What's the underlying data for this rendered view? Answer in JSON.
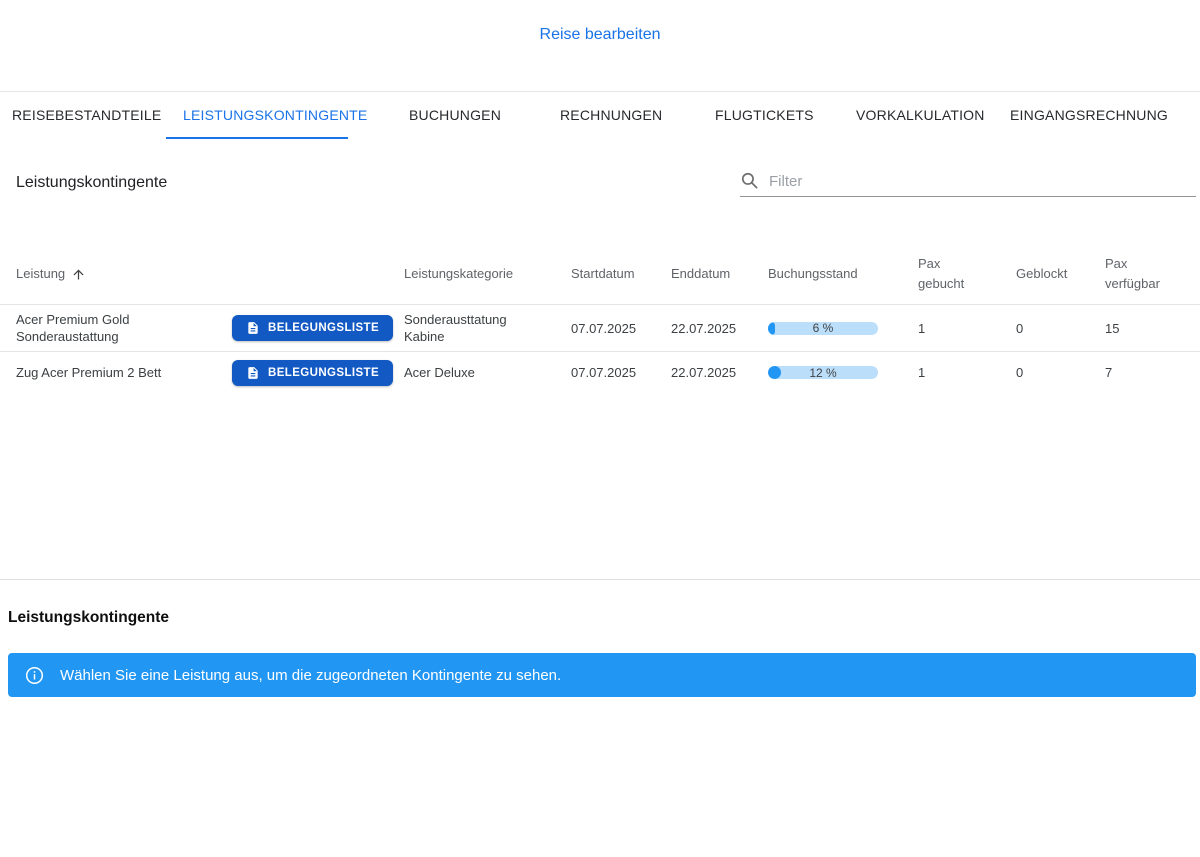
{
  "header": {
    "action_label": "Reise bearbeiten"
  },
  "tabs": {
    "active_index": 1,
    "items": [
      {
        "label": "REISEBESTANDTEILE"
      },
      {
        "label": "LEISTUNGSKONTINGENTE"
      },
      {
        "label": "BUCHUNGEN"
      },
      {
        "label": "RECHNUNGEN"
      },
      {
        "label": "FLUGTICKETS"
      },
      {
        "label": "VORKALKULATION"
      },
      {
        "label": "EINGANGSRECHNUNG"
      }
    ]
  },
  "kontingente_section": {
    "title": "Leistungskontingente",
    "filter": {
      "icon": "search-icon",
      "placeholder": "Filter",
      "value": ""
    },
    "table": {
      "columns": {
        "leistung": "Leistung",
        "sort_icon": "arrow-up-icon",
        "belegungsliste": "",
        "leistungskategorie": "Leistungskategorie",
        "startdatum": "Startdatum",
        "enddatum": "Enddatum",
        "buchungsstand": "Buchungsstand",
        "pax_gebucht": "Pax gebucht",
        "geblockt": "Geblockt",
        "pax_verfuegbar": "Pax verfügbar"
      },
      "rows": [
        {
          "leistung": "Acer Premium Gold Sonderaustattung",
          "belegungsliste_label": "BELEGUNGSLISTE",
          "leistungskategorie": "Sonderausttatung Kabine",
          "startdatum": "07.07.2025",
          "enddatum": "22.07.2025",
          "buchungsstand_percent": 6,
          "buchungsstand_label": "6 %",
          "pax_gebucht": "1",
          "geblockt": "0",
          "pax_verfuegbar": "15"
        },
        {
          "leistung": "Zug Acer Premium 2 Bett",
          "belegungsliste_label": "BELEGUNGSLISTE",
          "leistungskategorie": "Acer Deluxe",
          "startdatum": "07.07.2025",
          "enddatum": "22.07.2025",
          "buchungsstand_percent": 12,
          "buchungsstand_label": "12 %",
          "pax_gebucht": "1",
          "geblockt": "0",
          "pax_verfuegbar": "7"
        }
      ]
    }
  },
  "detail_section": {
    "title": "Leistungskontingente",
    "info_banner": {
      "icon": "info-icon",
      "text": "Wählen Sie eine Leistung aus, um die zugeordneten Kontingente zu sehen."
    }
  },
  "colors": {
    "link_blue": "#1a73e8",
    "active_tab_blue": "#1a73e8",
    "button_blue": "#1259c3",
    "banner_blue": "#2196f3",
    "progress_fill": "#2196f3",
    "progress_track": "#bbdefb"
  }
}
